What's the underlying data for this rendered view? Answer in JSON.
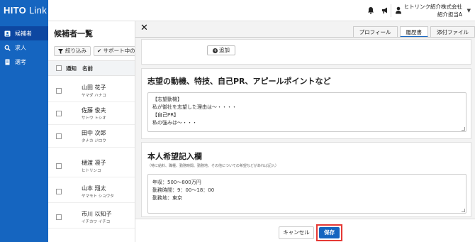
{
  "app": {
    "logo_bold": "HITO",
    "logo_thin": " Link"
  },
  "header": {
    "company": "ヒトリンク紹介株式会社",
    "user": "紹介担当A"
  },
  "sidebar": {
    "items": [
      {
        "label": "候補者",
        "icon": "person-card-icon"
      },
      {
        "label": "求人",
        "icon": "search-icon"
      },
      {
        "label": "選考",
        "icon": "document-icon"
      }
    ]
  },
  "list": {
    "title": "候補者一覧",
    "filter_label": "絞り込み",
    "support_label": "サポート中のみ",
    "columns": [
      "通知",
      "名前"
    ],
    "rows": [
      {
        "name": "山田 花子",
        "kana": "ヤマダ ハナコ"
      },
      {
        "name": "佐藤 俊夫",
        "kana": "サトウ トシオ"
      },
      {
        "name": "田中 次郎",
        "kana": "タナカ ジロウ"
      },
      {
        "name": "樋渡 凛子",
        "kana": "ヒトリンコ"
      },
      {
        "name": "山本 翔太",
        "kana": "ヤマモト ショウタ"
      },
      {
        "name": "市川 以知子",
        "kana": "イチカワ イチコ"
      }
    ]
  },
  "modal": {
    "tabs": [
      "プロフィール",
      "履歴書",
      "添付ファイル"
    ],
    "active_tab": 1,
    "add_label": "追加",
    "motivation": {
      "title": "志望の動機、特技、自己PR、アピールポイントなど",
      "lines": [
        "【志望動機】",
        "私が御社を志望した理由は〜・・・・",
        "【自己PR】",
        "私の強みは〜・・・"
      ]
    },
    "request": {
      "title": "本人希望記入欄",
      "subtitle": "（特に給料、職種、勤務時間、勤務地、その他についての希望などがあれば記入）",
      "lines": [
        "年収：500〜800万円",
        "勤務時間：9：00〜18：00",
        "勤務地：東京"
      ]
    },
    "cancel_label": "キャンセル",
    "save_label": "保存"
  },
  "colors": {
    "brand": "#1565c0",
    "highlight": "#e53935"
  }
}
